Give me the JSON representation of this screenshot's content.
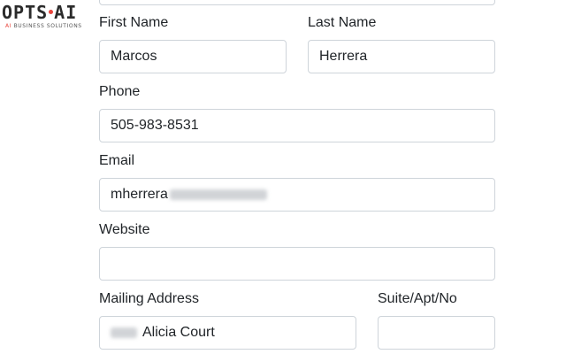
{
  "logo": {
    "main": "OPTS·AI",
    "sub_prefix": "AI",
    "sub_rest": " BUSINESS SOLUTIONS"
  },
  "form": {
    "first_name": {
      "label": "First Name",
      "value": "Marcos"
    },
    "last_name": {
      "label": "Last Name",
      "value": "Herrera"
    },
    "phone": {
      "label": "Phone",
      "value": "505-983-8531"
    },
    "email": {
      "label": "Email",
      "value": "mherrera"
    },
    "website": {
      "label": "Website",
      "value": ""
    },
    "mailing_address": {
      "label": "Mailing Address",
      "value": "Alicia Court"
    },
    "suite": {
      "label": "Suite/Apt/No",
      "value": ""
    }
  },
  "colors": {
    "border": "#ced4da",
    "text": "#212529",
    "logo_accent": "#e8453c"
  }
}
